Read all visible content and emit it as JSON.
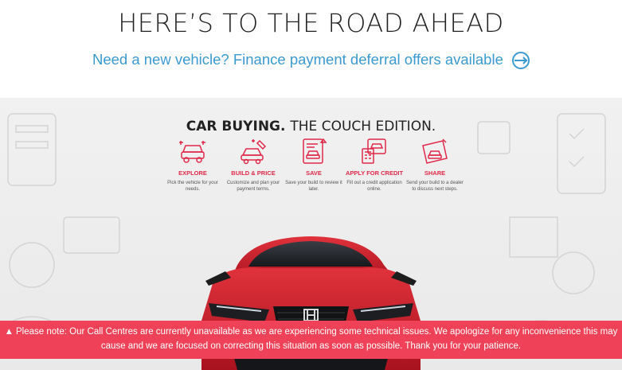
{
  "header": {
    "headline": "HERE’S TO THE ROAD AHEAD",
    "promo_link": "Need a new vehicle? Finance payment deferral offers available",
    "promo_icon": "arrow-circle-icon"
  },
  "hero": {
    "title_bold": "CAR BUYING.",
    "title_light": "THE COUCH EDITION.",
    "steps": [
      {
        "title": "EXPLORE",
        "desc": "Pick the vehicle for your needs.",
        "icon": "car-explore-icon"
      },
      {
        "title": "BUILD & PRICE",
        "desc": "Customize and plan your payment terms.",
        "icon": "car-build-icon"
      },
      {
        "title": "SAVE",
        "desc": "Save your build to review it later.",
        "icon": "car-save-icon"
      },
      {
        "title": "APPLY FOR CREDIT",
        "desc": "Fill out a credit application online.",
        "icon": "credit-apply-icon"
      },
      {
        "title": "SHARE",
        "desc": "Send your build to a dealer to discuss next steps.",
        "icon": "share-icon"
      }
    ],
    "accent_color": "#e0294a"
  },
  "notice": {
    "icon": "warning-icon",
    "text": "Please note: Our Call Centres are currently unavailable as we are experiencing some technical issues. We apologize for any inconvenience this may cause and we are focused on correcting this situation as soon as possible. Thank you for your patience.",
    "background": "#ef4157"
  }
}
